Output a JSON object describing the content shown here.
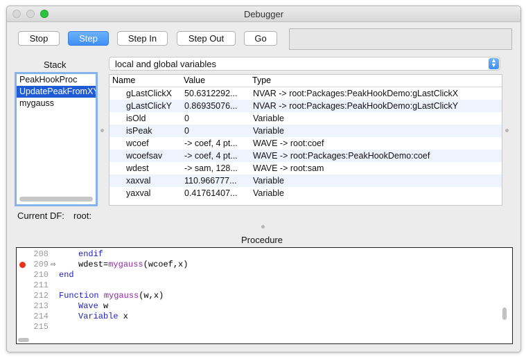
{
  "window": {
    "title": "Debugger"
  },
  "toolbar": {
    "stop": "Stop",
    "step": "Step",
    "step_in": "Step In",
    "step_out": "Step Out",
    "go": "Go"
  },
  "stack": {
    "label": "Stack",
    "items": [
      "PeakHookProc",
      "UpdatePeakFromXY",
      "mygauss"
    ],
    "selected_index": 1
  },
  "current_df": {
    "label": "Current DF:",
    "value": "root:"
  },
  "variables": {
    "scope_select": "local and global variables",
    "columns": {
      "name": "Name",
      "value": "Value",
      "type": "Type"
    },
    "rows": [
      {
        "name": "gLastClickX",
        "value": "50.6312292...",
        "type": "NVAR -> root:Packages:PeakHookDemo:gLastClickX"
      },
      {
        "name": "gLastClickY",
        "value": "0.86935076...",
        "type": "NVAR -> root:Packages:PeakHookDemo:gLastClickY"
      },
      {
        "name": "isOld",
        "value": "0",
        "type": "Variable"
      },
      {
        "name": "isPeak",
        "value": "0",
        "type": "Variable"
      },
      {
        "name": "wcoef",
        "value": "-> coef, 4 pt...",
        "type": "WAVE -> root:coef"
      },
      {
        "name": "wcoefsav",
        "value": "-> coef, 4 pt...",
        "type": "WAVE -> root:Packages:PeakHookDemo:coef"
      },
      {
        "name": "wdest",
        "value": "-> sam, 128...",
        "type": "WAVE -> root:sam"
      },
      {
        "name": "xaxval",
        "value": "110.966777...",
        "type": "Variable"
      },
      {
        "name": "yaxval",
        "value": "0.41761407...",
        "type": "Variable"
      }
    ]
  },
  "procedure": {
    "label": "Procedure",
    "lines": [
      {
        "num": "208",
        "text": "endif"
      },
      {
        "num": "209",
        "text": "wdest=mygauss(wcoef,x)"
      },
      {
        "num": "210",
        "text": "end"
      },
      {
        "num": "211",
        "text": ""
      },
      {
        "num": "212",
        "text": "Function mygauss(w,x)"
      },
      {
        "num": "213",
        "text": "Wave w"
      },
      {
        "num": "214",
        "text": "Variable x"
      },
      {
        "num": "215",
        "text": ""
      }
    ],
    "breakpoint_line": "209",
    "current_line": "209"
  },
  "colors": {
    "accent": "#3f8ef5",
    "selection": "#1f5bd6",
    "breakpoint": "#e8321b",
    "keyword": "#1f1fbd",
    "function": "#8e2aa3"
  }
}
